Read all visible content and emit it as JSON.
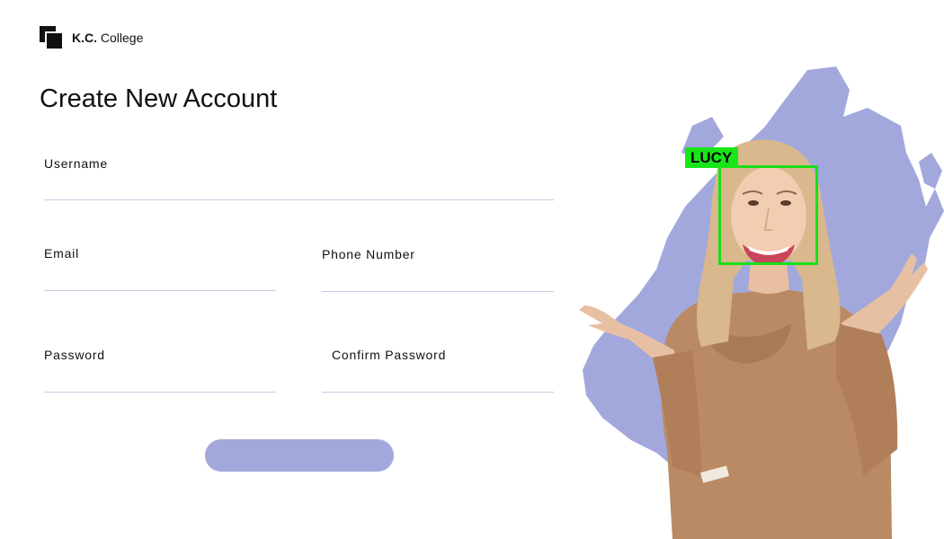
{
  "brand": {
    "bold": "K.C.",
    "name": "College",
    "logo_icon": "stacked-squares-icon"
  },
  "title": "Create New Account",
  "form": {
    "username": {
      "label": "Username",
      "value": "",
      "placeholder": ""
    },
    "email": {
      "label": "Email",
      "value": "",
      "placeholder": ""
    },
    "phone": {
      "label": "Phone Number",
      "value": "",
      "placeholder": ""
    },
    "password": {
      "label": "Password",
      "value": "",
      "placeholder": ""
    },
    "confirm_password": {
      "label": "Confirm Password",
      "value": "",
      "placeholder": ""
    },
    "submit_label": ""
  },
  "detection": {
    "label": "LUCY",
    "box_color": "#18e018"
  },
  "colors": {
    "accent": "#a3a8dc",
    "text": "#111111",
    "underline": "#c9c9e6"
  }
}
